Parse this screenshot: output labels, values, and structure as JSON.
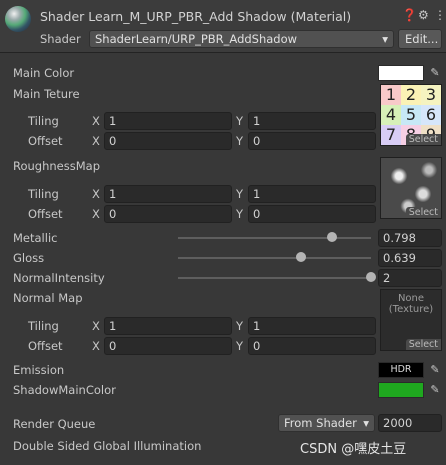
{
  "header": {
    "title": "Shader Learn_M_URP_PBR_Add Shadow (Material)",
    "shader_label": "Shader",
    "shader_value": "ShaderLearn/URP_PBR_AddShadow",
    "edit_label": "Edit..."
  },
  "props": {
    "main_color": "Main Color",
    "main_texture": "Main Teture",
    "tiling": "Tiling",
    "offset": "Offset",
    "x": "X",
    "y": "Y",
    "main_tiling_x": "1",
    "main_tiling_y": "1",
    "main_offset_x": "0",
    "main_offset_y": "0",
    "roughness_map": "RoughnessMap",
    "rough_tiling_x": "1",
    "rough_tiling_y": "1",
    "rough_offset_x": "0",
    "rough_offset_y": "0",
    "metallic": "Metallic",
    "metallic_value": "0.798",
    "gloss": "Gloss",
    "gloss_value": "0.639",
    "normal_intensity": "NormalIntensity",
    "normal_intensity_value": "2",
    "normal_map": "Normal Map",
    "normal_tiling_x": "1",
    "normal_tiling_y": "1",
    "normal_offset_x": "0",
    "normal_offset_y": "0",
    "normal_none_line1": "None",
    "normal_none_line2": "(Texture)",
    "select_label": "Select",
    "emission": "Emission",
    "hdr_label": "HDR",
    "shadow_main_color": "ShadowMainColor",
    "render_queue": "Render Queue",
    "render_queue_mode": "From Shader",
    "render_queue_value": "2000",
    "double_sided_gi": "Double Sided Global Illumination",
    "watermark": "CSDN @嘿皮土豆"
  },
  "numbers_tex": [
    "1",
    "2",
    "3",
    "4",
    "5",
    "6",
    "7",
    "8",
    "9"
  ],
  "sliders": {
    "metallic": 0.798,
    "gloss": 0.639,
    "normal_intensity": 1.0
  },
  "colors": {
    "main_color": "#ffffff",
    "emission": "#000000",
    "shadow_main_color": "#1fa81f"
  },
  "icons": [
    "help-icon",
    "settings-icon",
    "menu-icon",
    "eyedropper-icon",
    "dropdown-caret-icon"
  ]
}
